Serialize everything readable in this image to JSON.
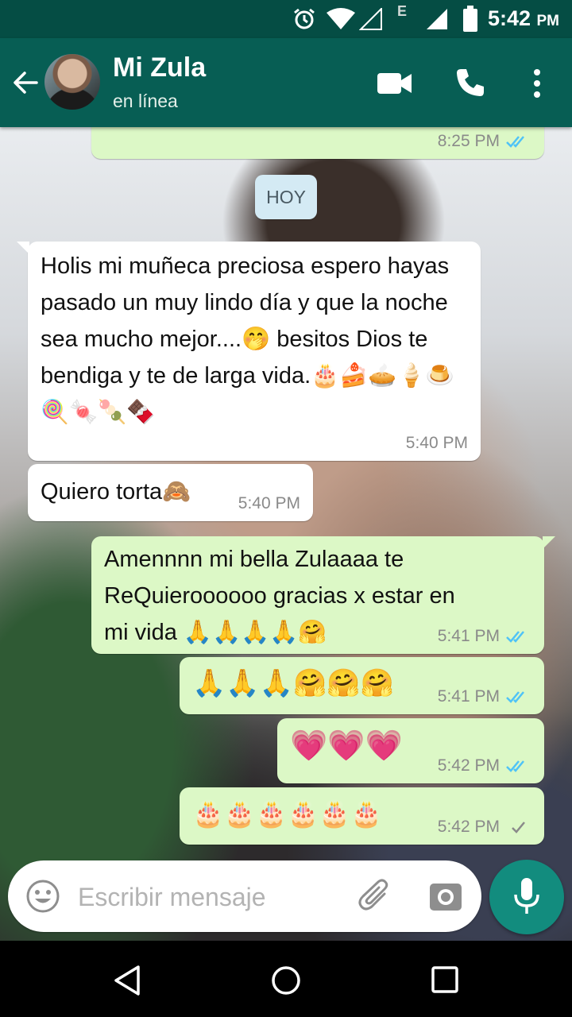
{
  "status_bar": {
    "time": "5:42",
    "ampm": "PM"
  },
  "header": {
    "contact_name": "Mi Zula",
    "contact_status": "en línea"
  },
  "chat": {
    "previous_time": "8:25 PM",
    "day_chip": "HOY",
    "messages": [
      {
        "direction": "in",
        "text": "Holis mi muñeca preciosa espero hayas pasado un muy lindo día y que la noche sea mucho mejor....🤭 besitos Dios te bendiga y te de larga vida.🎂🍰🥧🍦🍮🍭🍬🍡🍫",
        "time": "5:40 PM"
      },
      {
        "direction": "in",
        "text": "Quiero torta🙈",
        "time": "5:40 PM"
      },
      {
        "direction": "out",
        "text": "Amennnn mi bella Zulaaaa te ReQuieroooooo gracias x estar en mi vida 🙏🙏🙏🙏🤗",
        "time": "5:41 PM",
        "status": "read"
      },
      {
        "direction": "out",
        "text": "🙏🙏🙏🤗🤗🤗",
        "time": "5:41 PM",
        "status": "read"
      },
      {
        "direction": "out",
        "text": "💗💗💗",
        "time": "5:42 PM",
        "status": "read"
      },
      {
        "direction": "out",
        "text": "🎂🎂🎂🎂🎂🎂",
        "time": "5:42 PM",
        "status": "sent"
      }
    ]
  },
  "composer": {
    "placeholder": "Escribir mensaje"
  },
  "icons": [
    "alarm-icon",
    "wifi-icon",
    "signal-icon",
    "battery-icon",
    "back-arrow-icon",
    "video-call-icon",
    "phone-call-icon",
    "more-options-icon",
    "emoji-icon",
    "attach-icon",
    "camera-icon",
    "mic-icon",
    "nav-back-icon",
    "nav-home-icon",
    "nav-recents-icon"
  ],
  "colors": {
    "header": "#075e54",
    "status_bar": "#054d44",
    "outgoing_bubble": "#dcf8c6",
    "incoming_bubble": "#ffffff",
    "read_ticks": "#4fc3f7",
    "fab": "#128c7e"
  }
}
